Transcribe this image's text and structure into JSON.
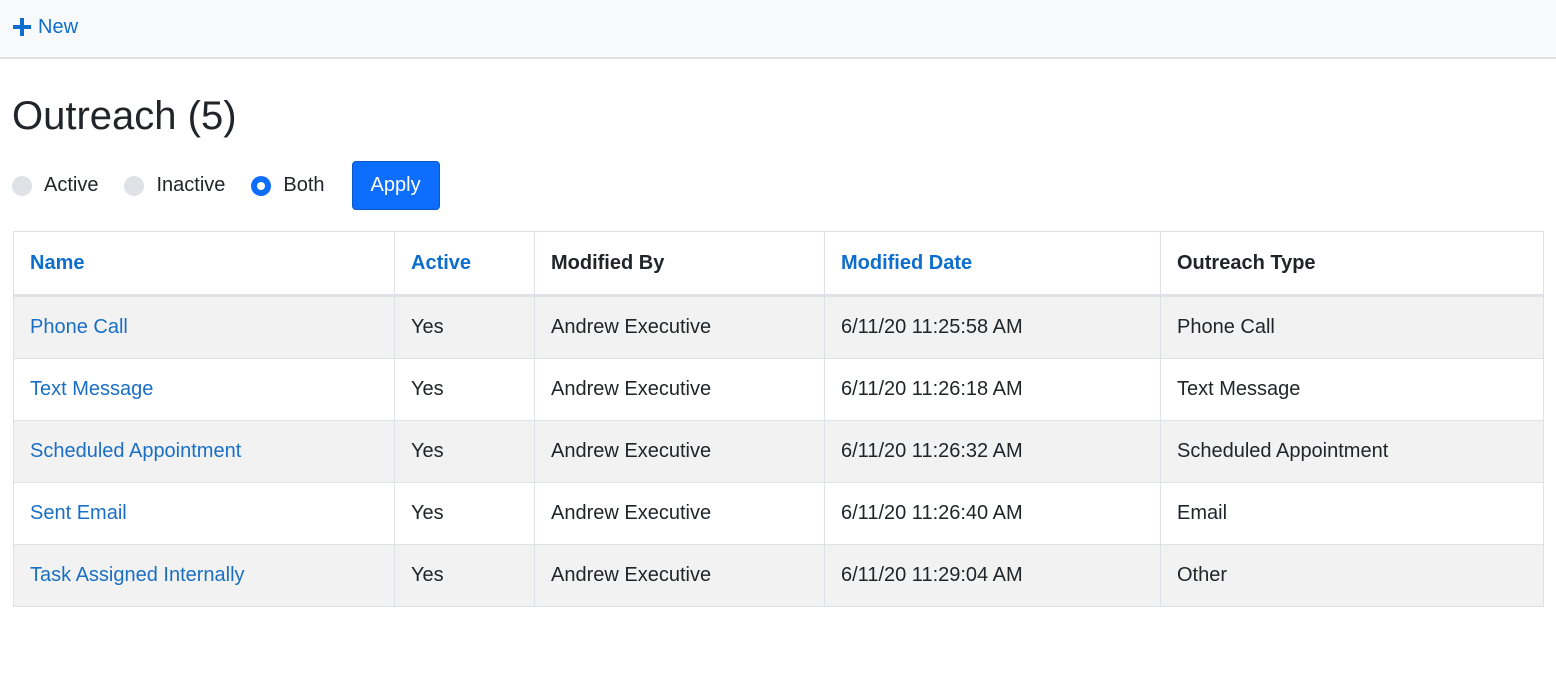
{
  "toolbar": {
    "new_label": "New"
  },
  "page": {
    "title": "Outreach (5)"
  },
  "filters": {
    "options": [
      {
        "label": "Active",
        "checked": false
      },
      {
        "label": "Inactive",
        "checked": false
      },
      {
        "label": "Both",
        "checked": true
      }
    ],
    "apply_label": "Apply"
  },
  "table": {
    "columns": [
      {
        "label": "Name",
        "sortable": true
      },
      {
        "label": "Active",
        "sortable": true
      },
      {
        "label": "Modified By",
        "sortable": false
      },
      {
        "label": "Modified Date",
        "sortable": true
      },
      {
        "label": "Outreach Type",
        "sortable": false
      }
    ],
    "rows": [
      {
        "name": "Phone Call",
        "active": "Yes",
        "modified_by": "Andrew Executive",
        "modified_date": "6/11/20 11:25:58 AM",
        "type": "Phone Call"
      },
      {
        "name": "Text Message",
        "active": "Yes",
        "modified_by": "Andrew Executive",
        "modified_date": "6/11/20 11:26:18 AM",
        "type": "Text Message"
      },
      {
        "name": "Scheduled Appointment",
        "active": "Yes",
        "modified_by": "Andrew Executive",
        "modified_date": "6/11/20 11:26:32 AM",
        "type": "Scheduled Appointment"
      },
      {
        "name": "Sent Email",
        "active": "Yes",
        "modified_by": "Andrew Executive",
        "modified_date": "6/11/20 11:26:40 AM",
        "type": "Email"
      },
      {
        "name": "Task Assigned Internally",
        "active": "Yes",
        "modified_by": "Andrew Executive",
        "modified_date": "6/11/20 11:29:04 AM",
        "type": "Other"
      }
    ]
  },
  "colors": {
    "link": "#1a6fc4",
    "primary": "#0d6efd",
    "stripe": "#f2f2f2",
    "toolbar_bg": "#f8f9fa"
  },
  "icons": {
    "new": "plus-icon"
  }
}
